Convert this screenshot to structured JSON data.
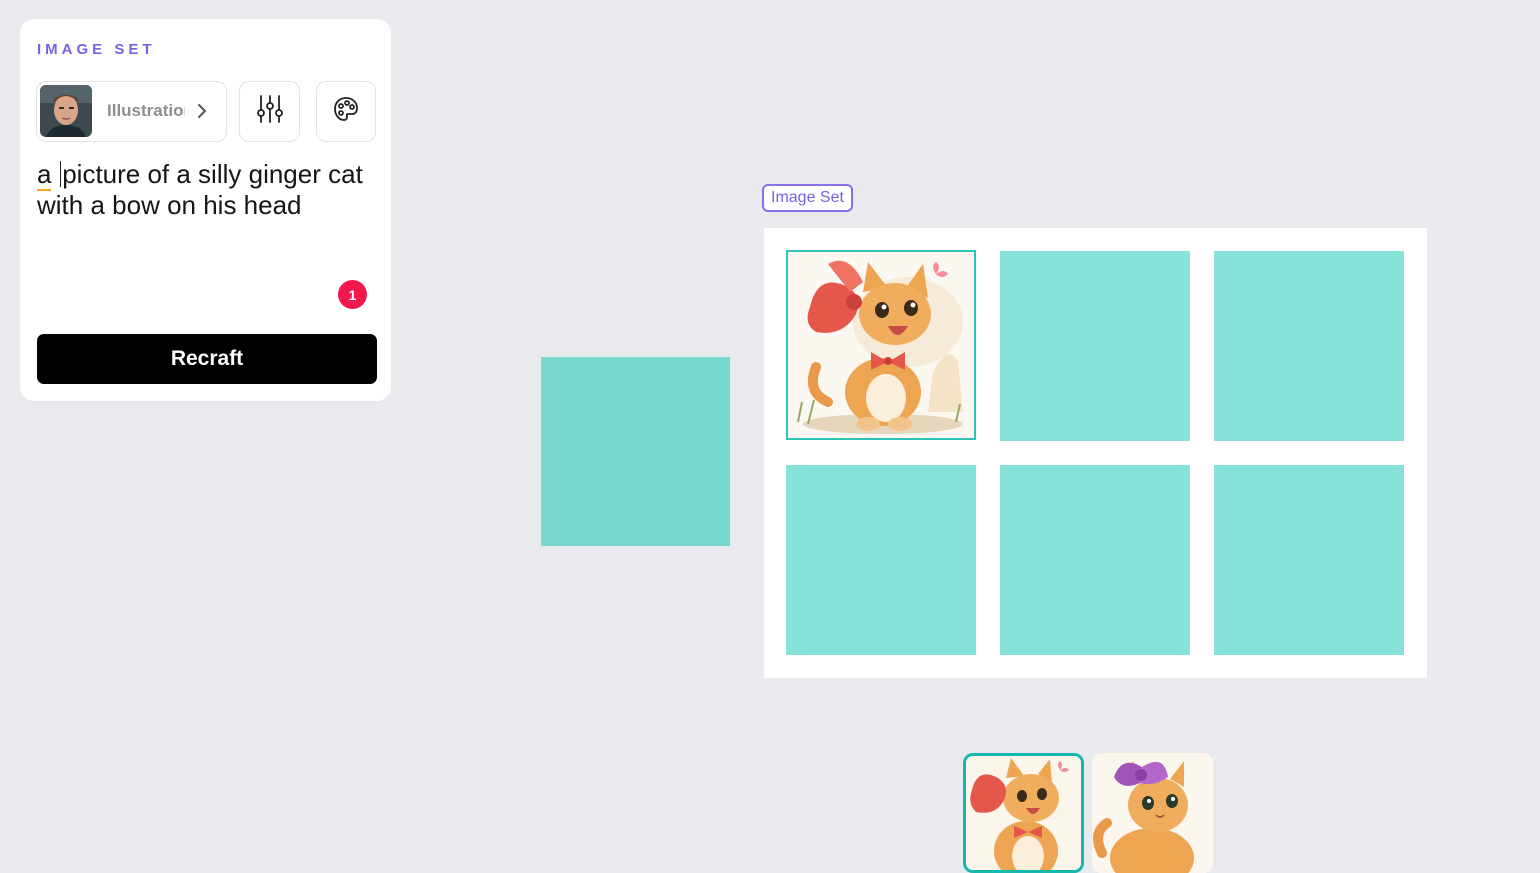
{
  "panel": {
    "title": "IMAGE SET",
    "style_label": "Illustration",
    "prompt_first_word": "a",
    "prompt_rest": "picture of a silly ginger cat with a bow on his head",
    "badge_count": "1",
    "recraft_label": "Recraft",
    "icons": {
      "style": "avatar-portrait",
      "settings": "sliders-icon",
      "palette": "palette-icon"
    }
  },
  "canvas": {
    "set_tag_label": "Image Set",
    "grid": {
      "rows": 2,
      "cols": 3,
      "selected_index": 0
    },
    "tile_color": "#87e3da",
    "loose_tile_color": "#78d8d0",
    "selection_color": "#2fc2b6"
  },
  "thumbnails": [
    {
      "name": "ginger-kitten-red-bow",
      "active": true
    },
    {
      "name": "ginger-cat-purple-bow",
      "active": false
    }
  ],
  "colors": {
    "accent": "#7b5fe5",
    "badge": "#f0184d",
    "button": "#000000",
    "background": "#e9eaee"
  }
}
